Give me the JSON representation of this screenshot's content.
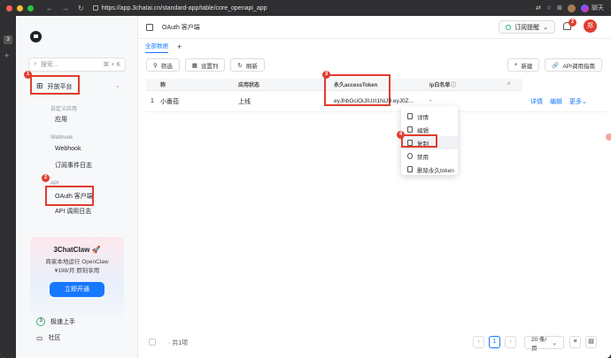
{
  "browser": {
    "url": "https://app.3chatai.cn/standard-app/table/core_openapi_app",
    "chat_label": "聊天"
  },
  "sidebar": {
    "search_placeholder": "搜索...",
    "search_shortcut": "⌘ + K",
    "open_platform_label": "开放平台",
    "sections": [
      {
        "label": "自定义应用",
        "items": [
          "应用"
        ]
      },
      {
        "label": "Webhook",
        "items": [
          "Webhook",
          "订阅事件日志"
        ]
      },
      {
        "label": "API",
        "items": [
          "OAuth 客户端",
          "API 调用日志"
        ]
      }
    ],
    "promo": {
      "title": "3ChatClaw 🚀",
      "line1": "商家本地运行 OpenClaw",
      "line2": "¥198/月 即刻享用",
      "button": "立即开通"
    },
    "quick_start": "极速上手",
    "quick_start_count": "3",
    "community": "社区"
  },
  "annotations": [
    "1",
    "2",
    "3",
    "4"
  ],
  "main": {
    "page_title": "OAuth 客户端",
    "subscribe_label": "订阅提醒",
    "notification_count": "2",
    "user_initial": "郑",
    "tab_all": "全部数据",
    "toolbar": {
      "filter": "筛选",
      "columns": "设置列",
      "refresh": "刷新",
      "new": "新建",
      "api_guide": "API调用指南"
    },
    "table": {
      "headers": [
        "称",
        "应用状态",
        "永久accessToken",
        "Ip白名单"
      ],
      "row": {
        "index": "1",
        "name": "小番茄",
        "status": "上线",
        "token": "eyJhbGciOiJIUzI1NiJ9.eyJ0Z...",
        "ip": "-",
        "actions": [
          "详情",
          "编辑",
          "更多"
        ]
      }
    },
    "context_menu": [
      "详情",
      "编辑",
      "复制",
      "禁用",
      "删除永久token"
    ],
    "footer": {
      "total": "共1项",
      "page": "1",
      "page_size": "20 条/页"
    }
  }
}
